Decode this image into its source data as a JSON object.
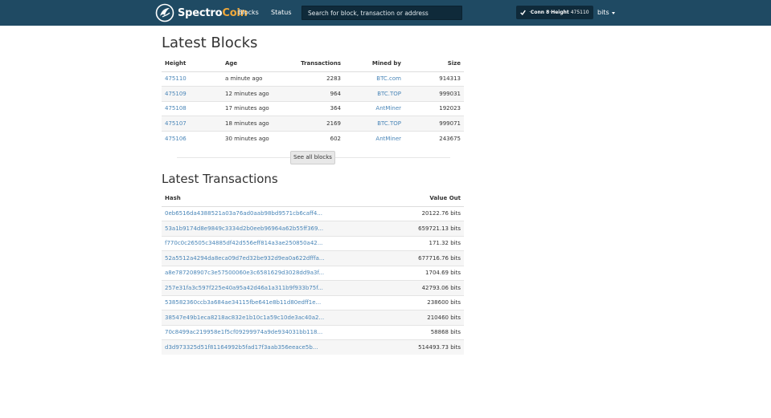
{
  "nav": {
    "brand_prefix": "Spectro",
    "brand_suffix": "Coin",
    "blocks_label": "Blocks",
    "status_label": "Status",
    "search_placeholder": "Search for block, transaction or address",
    "conn_label": "Conn 8",
    "conn_sep": " · ",
    "height_label": "Height",
    "height_value": "475110",
    "units_label": "bits"
  },
  "colors": {
    "navbar": "#1f4a63",
    "link": "#4a86b8",
    "brand_accent": "#f0a83a"
  },
  "blocks": {
    "title": "Latest Blocks",
    "headers": {
      "height": "Height",
      "age": "Age",
      "transactions": "Transactions",
      "mined_by": "Mined by",
      "size": "Size"
    },
    "rows": [
      {
        "height": "475110",
        "age": "a minute ago",
        "transactions": "2283",
        "mined_by": "BTC.com",
        "size": "914313"
      },
      {
        "height": "475109",
        "age": "12 minutes ago",
        "transactions": "964",
        "mined_by": "BTC.TOP",
        "size": "999031"
      },
      {
        "height": "475108",
        "age": "17 minutes ago",
        "transactions": "364",
        "mined_by": "AntMiner",
        "size": "192023"
      },
      {
        "height": "475107",
        "age": "18 minutes ago",
        "transactions": "2169",
        "mined_by": "BTC.TOP",
        "size": "999071"
      },
      {
        "height": "475106",
        "age": "30 minutes ago",
        "transactions": "602",
        "mined_by": "AntMiner",
        "size": "243675"
      }
    ],
    "see_all_label": "See all blocks"
  },
  "transactions": {
    "title": "Latest Transactions",
    "headers": {
      "hash": "Hash",
      "value_out": "Value Out"
    },
    "rows": [
      {
        "hash": "0eb6516da4388521a03a76ad0aab98bd9571cb6caff4...",
        "value": "20122.76 bits"
      },
      {
        "hash": "53a1b9174d8e9849c3334d2b0eeb96964a62b55ff369...",
        "value": "659721.13 bits"
      },
      {
        "hash": "f770c0c26505c34885df42d556eff814a3ae250850a42...",
        "value": "171.32 bits"
      },
      {
        "hash": "52a5512a4294da8eca09d7ed32be932d9ea0a622dfffa...",
        "value": "677716.76 bits"
      },
      {
        "hash": "a8e787208907c3e57500060e3c6581629d3028dd9a3f...",
        "value": "1704.69 bits"
      },
      {
        "hash": "257e31fa3c597f225e40a95a42d46a1a311b9f933b75f...",
        "value": "42793.06 bits"
      },
      {
        "hash": "538582360ccb3a684ae34115fbe641e8b11d80edff1e...",
        "value": "238600 bits"
      },
      {
        "hash": "38547e49b1eca8218ac832e1b10c1a59c10de3ac40a2...",
        "value": "210460 bits"
      },
      {
        "hash": "70c8499ac219958e1f5cf09299974a9de934031bb118...",
        "value": "58868 bits"
      },
      {
        "hash": "d3d973325d51f81164992b5fad17f3aab356eeace5b...",
        "value": "514493.73 bits"
      }
    ]
  }
}
